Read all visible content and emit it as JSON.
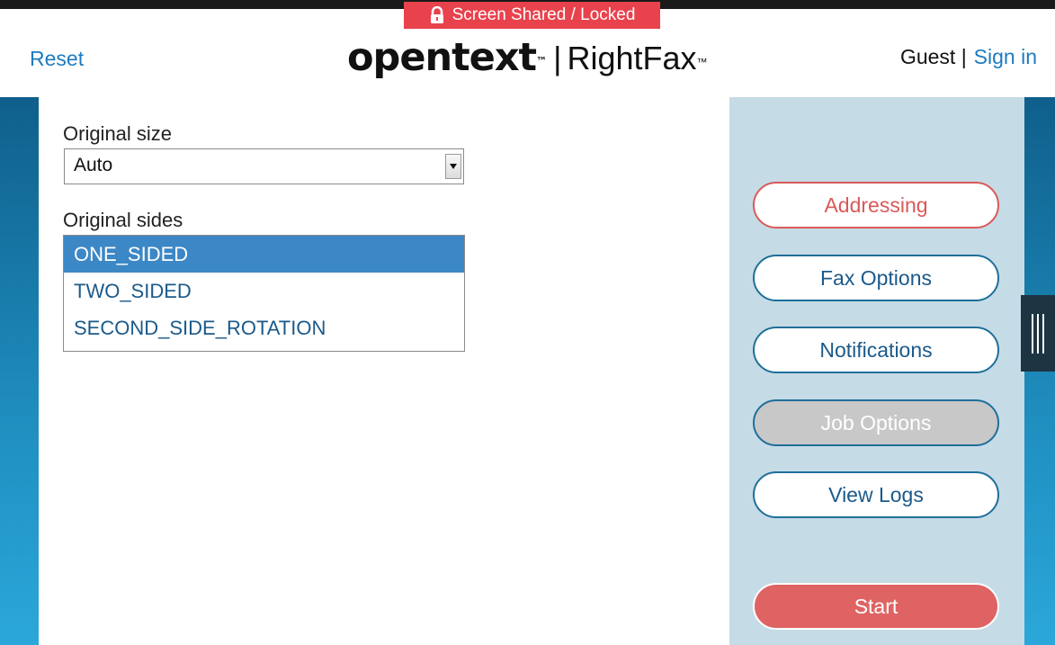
{
  "header": {
    "reset_label": "Reset",
    "lock_banner": "Screen Shared / Locked",
    "brand_opentext": "opentext",
    "brand_tm": "™",
    "brand_separator": "|",
    "brand_rightfax": "RightFax",
    "user_label": "Guest |",
    "sign_in_label": "Sign in"
  },
  "form": {
    "original_size_label": "Original size",
    "original_size_value": "Auto",
    "original_sides_label": "Original sides",
    "original_sides_options": [
      "ONE_SIDED",
      "TWO_SIDED",
      "SECOND_SIDE_ROTATION"
    ],
    "original_sides_selected": "ONE_SIDED"
  },
  "side_panel": {
    "buttons": [
      {
        "label": "Addressing",
        "state": "active"
      },
      {
        "label": "Fax Options",
        "state": "normal"
      },
      {
        "label": "Notifications",
        "state": "normal"
      },
      {
        "label": "Job Options",
        "state": "disabled"
      },
      {
        "label": "View Logs",
        "state": "normal"
      }
    ],
    "start_label": "Start"
  },
  "icons": {
    "lock": "lock-icon",
    "dropdown": "chevron-down-icon",
    "drawer_handle": "drag-handle-icon"
  },
  "colors": {
    "accent_blue": "#1e7bbf",
    "banner_red": "#e8424d",
    "start_red": "#df6363",
    "panel_bg": "#c5dbe6",
    "selected_row": "#3c87c6"
  }
}
